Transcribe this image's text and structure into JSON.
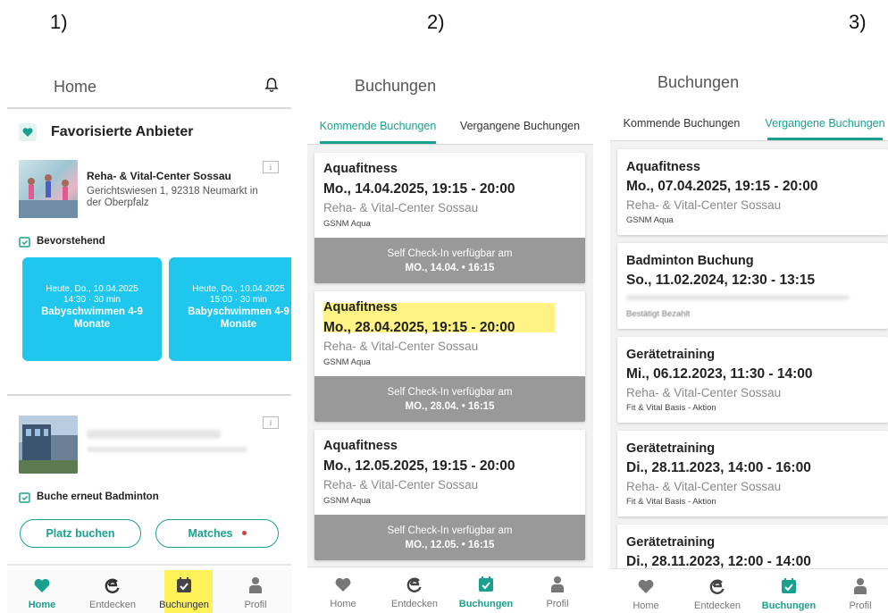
{
  "labels": {
    "s1": "1)",
    "s2": "2)",
    "s3": "3)"
  },
  "colors": {
    "accent": "#1aa08e",
    "tile": "#1fc7ef",
    "checkin": "#999999",
    "highlight": "#fff05a"
  },
  "nav": {
    "home": "Home",
    "discover": "Entdecken",
    "bookings": "Buchungen",
    "profile": "Profil"
  },
  "home": {
    "title": "Home",
    "favorites_title": "Favorisierte Anbieter",
    "provider": {
      "name": "Reha- & Vital-Center Sossau",
      "address_line1": "Gerichtswiesen 1, 92318 Neumarkt in",
      "address_line2": "der Oberpfalz",
      "info": "i"
    },
    "upcoming_label": "Bevorstehend",
    "tiles": [
      {
        "date": "Heute, Do., 10.04.2025",
        "time": "14:30 · 30 min",
        "name1": "Babyschwimmen 4-9",
        "name2": "Monate"
      },
      {
        "date": "Heute, Do., 10.04.2025",
        "time": "15:00 · 30 min",
        "name1": "Babyschwimmen 4-9",
        "name2": "Monate"
      }
    ],
    "provider2_info": "i",
    "rebook_label": "Buche erneut Badminton",
    "book_court": "Platz buchen",
    "matches": "Matches"
  },
  "upcoming": {
    "title": "Buchungen",
    "tab_upcoming": "Kommende Buchungen",
    "tab_past": "Vergangene Buchungen",
    "cards": [
      {
        "title": "Aquafitness",
        "date": "Mo., 14.04.2025, 19:15 - 20:00",
        "venue": "Reha- & Vital-Center Sossau",
        "sub": "GSNM Aqua",
        "checkin": "Self Check-In verfügbar am",
        "checkin_time": "MO., 14.04. • 16:15"
      },
      {
        "title": "Aquafitness",
        "date": "Mo., 28.04.2025, 19:15 - 20:00",
        "venue": "Reha- & Vital-Center Sossau",
        "sub": "GSNM Aqua",
        "checkin": "Self Check-In verfügbar am",
        "checkin_time": "MO., 28.04. • 16:15"
      },
      {
        "title": "Aquafitness",
        "date": "Mo., 12.05.2025, 19:15 - 20:00",
        "venue": "Reha- & Vital-Center Sossau",
        "sub": "GSNM Aqua",
        "checkin": "Self Check-In verfügbar am",
        "checkin_time": "MO., 12.05. • 16:15"
      }
    ]
  },
  "past": {
    "title": "Buchungen",
    "tab_upcoming": "Kommende Buchungen",
    "tab_past": "Vergangene Buchungen",
    "cards": [
      {
        "title": "Aquafitness",
        "date": "Mo., 07.04.2025, 19:15 - 20:00",
        "venue": "Reha- & Vital-Center Sossau",
        "sub": "GSNM Aqua"
      },
      {
        "title": "Badminton Buchung",
        "date": "So., 11.02.2024, 12:30 - 13:15",
        "venue": "",
        "sub": "Bestätigt Bezahlt"
      },
      {
        "title": "Gerätetraining",
        "date": "Mi., 06.12.2023, 11:30 - 14:00",
        "venue": "Reha- & Vital-Center Sossau",
        "sub": "Fit & Vital Basis - Aktion"
      },
      {
        "title": "Gerätetraining",
        "date": "Di., 28.11.2023, 14:00 - 16:00",
        "venue": "Reha- & Vital-Center Sossau",
        "sub": "Fit & Vital Basis - Aktion"
      },
      {
        "title": "Gerätetraining",
        "date": "Di., 28.11.2023, 12:00 - 14:00",
        "venue": "",
        "sub": ""
      }
    ]
  }
}
